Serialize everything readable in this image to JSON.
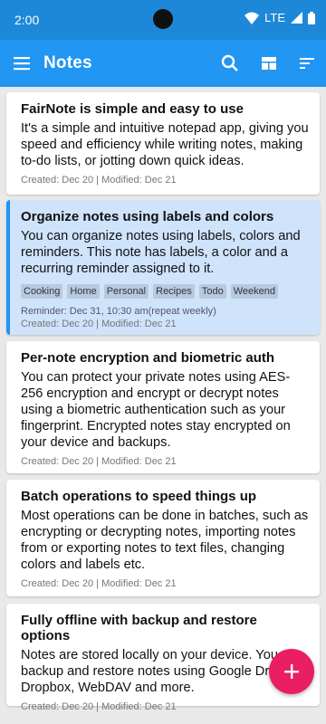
{
  "status": {
    "time": "2:00",
    "network": "LTE"
  },
  "appbar": {
    "title": "Notes"
  },
  "notes": [
    {
      "title": "FairNote is simple and easy to use",
      "content": "It's a simple and intuitive notepad app, giving you speed and efficiency while writing notes, making to-do lists, or jotting down quick ideas.",
      "meta": "Created: Dec 20 | Modified: Dec 21"
    },
    {
      "title": "Organize notes using labels and colors",
      "content": "You can organize notes using labels, colors and reminders. This note has labels, a color and a recurring reminder assigned to it.",
      "labels": [
        "Cooking",
        "Home",
        "Personal",
        "Recipes",
        "Todo",
        "Weekend"
      ],
      "reminder": "Reminder: Dec 31, 10:30 am(repeat weekly)",
      "meta": "Created: Dec 20 | Modified: Dec 21"
    },
    {
      "title": "Per-note encryption and biometric auth",
      "content": "You can protect your private notes using AES-256 encryption and encrypt or decrypt notes using a biometric authentication such as your fingerprint. Encrypted notes stay encrypted on your device and backups.",
      "meta": "Created: Dec 20 | Modified: Dec 21"
    },
    {
      "title": "Batch operations to speed things up",
      "content": "Most operations can be done in batches, such as encrypting or decrypting notes, importing notes from or exporting notes to text files, changing colors and labels etc.",
      "meta": "Created: Dec 20 | Modified: Dec 21"
    },
    {
      "title": "Fully offline with backup and restore options",
      "content": "Notes are stored locally on your device. You can backup and restore notes using Google Drive, Dropbox, WebDAV and more.",
      "meta": "Created: Dec 20 | Modified: Dec 21"
    }
  ],
  "colors": {
    "statusbar": "#1e88d8",
    "appbar": "#2196f3",
    "fab": "#e91e63",
    "selected_card": "#cfe3fb"
  },
  "icons": {
    "menu": "hamburger-menu-icon",
    "search": "search-icon",
    "layout": "grid-layout-icon",
    "sort": "sort-icon",
    "add": "add-icon"
  }
}
